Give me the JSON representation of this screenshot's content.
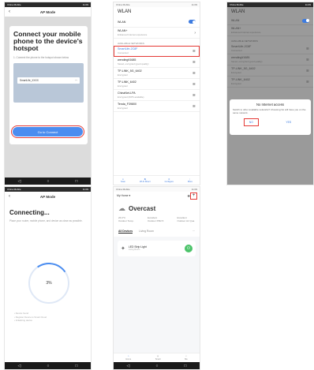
{
  "status": {
    "carrier": "China Mobile",
    "time": "11:09",
    "battery": "39%"
  },
  "phone1": {
    "title": "AP Mode",
    "headline": "Connect your mobile phone to the device's hotspot",
    "step": "1. Connect the phone to the hotspot shown below",
    "hotspot": "SmartLife_XXXX",
    "cta": "Go to Connect"
  },
  "phone2": {
    "title": "WLAN",
    "wlan_label": "WLAN",
    "wlan_plus": "WLAN+",
    "wlan_plus_sub": "Enhanced Internet experience",
    "section": "AVAILABLE NETWORKS",
    "networks": [
      {
        "name": "SmartLife-2C8F",
        "sub": "Connected"
      },
      {
        "name": "wending\\f1685",
        "sub": "Saved, encrypted (good quality)"
      },
      {
        "name": "TP-LINK_5G_6402",
        "sub": "Encrypted"
      },
      {
        "name": "TP-LINK_6402",
        "sub": "Encrypted"
      },
      {
        "name": "ChinaNet-LPA",
        "sub": "Encrypted (WPS available)"
      },
      {
        "name": "Tenda_F39800",
        "sub": "Encrypted"
      }
    ],
    "tabs": [
      "Scan",
      "Wi-Fi Direct",
      "Configure",
      "More"
    ]
  },
  "phone3": {
    "title": "WLAN",
    "dialog_title": "No Internet access",
    "dialog_msg": "Switch to other available networks? Choosing No will have you on the same network.",
    "no": "NO",
    "yes": "YES"
  },
  "phone4": {
    "title": "AP Mode",
    "headline": "Connecting...",
    "desc": "Place your router, mobile phone, and device as close as possible.",
    "progress": "3%",
    "steps": [
      "Device found",
      "Register Device to Smart Cloud",
      "Initializing device"
    ]
  },
  "phone5": {
    "home": "My Home",
    "weather": "Overcast",
    "stats": [
      {
        "value": "26.0°C",
        "label": "Outdoor Temp."
      },
      {
        "value": "Excellent",
        "label": "Outdoor PM2.5"
      },
      {
        "value": "Excellent",
        "label": "Outdoor Air Qua."
      }
    ],
    "tab_all": "All Devices",
    "tab_room": "Living Room",
    "device_name": "LED Strip Light",
    "device_sub": "Living Room",
    "nav": [
      "Home",
      "Smart",
      "Me"
    ]
  }
}
